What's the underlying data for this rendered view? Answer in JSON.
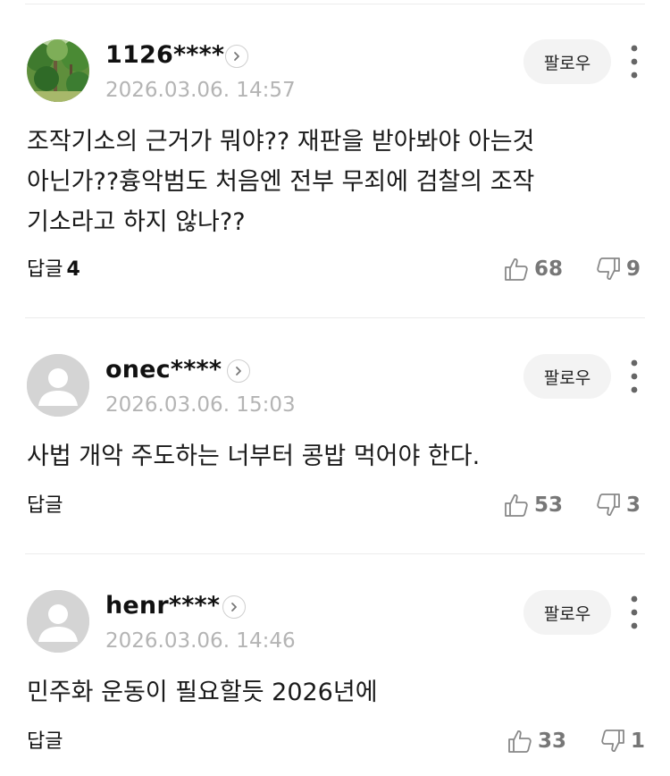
{
  "follow_label": "팔로우",
  "reply_label": "답글",
  "comments": [
    {
      "username": "1126****",
      "timestamp": "2026.03.06. 14:57",
      "text": "조작기소의 근거가 뭐야?? 재판을 받아봐야 아는것\n아닌가??흉악범도 처음엔 전부 무죄에 검찰의 조작\n기소라고 하지 않나??",
      "reply_count": "4",
      "likes": "68",
      "dislikes": "9"
    },
    {
      "username": "onec****",
      "timestamp": "2026.03.06. 15:03",
      "text": "사법 개악 주도하는 너부터 콩밥 먹어야 한다.",
      "reply_count": "",
      "likes": "53",
      "dislikes": "3"
    },
    {
      "username": "henr****",
      "timestamp": "2026.03.06. 14:46",
      "text": "민주화 운동이 필요할듯 2026년에",
      "reply_count": "",
      "likes": "33",
      "dislikes": "1"
    }
  ]
}
